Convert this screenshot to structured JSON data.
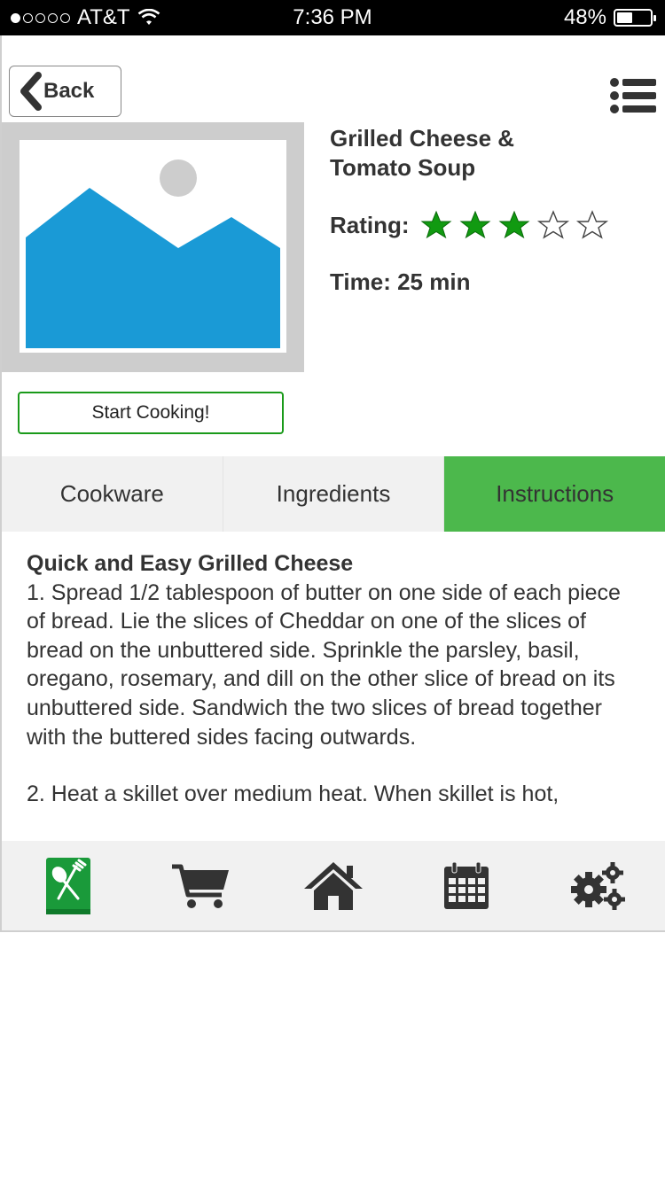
{
  "status_bar": {
    "carrier": "AT&T",
    "time": "7:36 PM",
    "battery_percent": "48%",
    "battery_level": 0.48,
    "signal_bars": 1
  },
  "header": {
    "back_label": "Back",
    "menu_icon": "list-icon"
  },
  "recipe": {
    "title": "Grilled Cheese & Tomato Soup",
    "rating_label": "Rating:",
    "rating": 3,
    "rating_max": 5,
    "time": "Time: 25 min",
    "image_icon": "image-placeholder-icon"
  },
  "start_button": "Start Cooking!",
  "tabs": [
    {
      "label": "Cookware",
      "active": false
    },
    {
      "label": "Ingredients",
      "active": false
    },
    {
      "label": "Instructions",
      "active": true
    }
  ],
  "instructions": {
    "heading": "Quick and Easy Grilled Cheese",
    "steps": [
      "1. Spread 1/2 tablespoon of butter on one side of each piece of bread. Lie the slices of Cheddar on one of the slices of bread on the unbuttered side. Sprinkle the parsley, basil, oregano, rosemary, and dill on the other slice of bread on its unbuttered side. Sandwich the two slices of bread together with the buttered sides facing outwards.",
      "2. Heat a skillet over medium heat. When skillet is hot,"
    ]
  },
  "bottom_nav": [
    {
      "icon": "recipe-book-icon",
      "active": true
    },
    {
      "icon": "cart-icon",
      "active": false
    },
    {
      "icon": "home-icon",
      "active": false
    },
    {
      "icon": "calendar-icon",
      "active": false
    },
    {
      "icon": "settings-icon",
      "active": false
    }
  ],
  "colors": {
    "accent": "#4cb84c",
    "star": "#119a11",
    "button_border": "#1a9a1a",
    "image_blue": "#1a9ad6"
  }
}
